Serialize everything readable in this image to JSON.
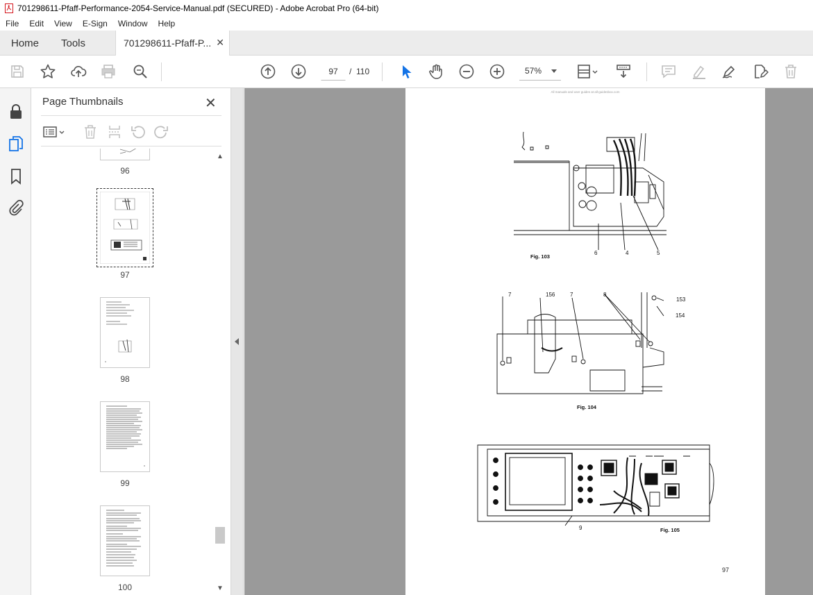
{
  "window": {
    "title": "701298611-Pfaff-Performance-2054-Service-Manual.pdf (SECURED) - Adobe Acrobat Pro (64-bit)"
  },
  "menu": [
    "File",
    "Edit",
    "View",
    "E-Sign",
    "Window",
    "Help"
  ],
  "tabs": {
    "home": "Home",
    "tools": "Tools",
    "document": "701298611-Pfaff-P...",
    "close": "✕"
  },
  "toolbar": {
    "current_page": "97",
    "page_separator": "/",
    "total_pages": "110",
    "zoom": "57%"
  },
  "panel": {
    "title": "Page Thumbnails",
    "close": "✕"
  },
  "thumbnails": [
    {
      "label": "96"
    },
    {
      "label": "97",
      "selected": true
    },
    {
      "label": "98"
    },
    {
      "label": "99"
    },
    {
      "label": "100"
    }
  ],
  "page": {
    "header": "All manuals and user guides at all-guidesbox.com",
    "number": "97",
    "figures": {
      "fig103": {
        "caption": "Fig. 103",
        "callouts": [
          "6",
          "4",
          "5"
        ]
      },
      "fig104": {
        "caption": "Fig. 104",
        "callouts": [
          "7",
          "156",
          "7",
          "8",
          "153",
          "154"
        ]
      },
      "fig105": {
        "caption": "Fig. 105",
        "callouts": [
          "9"
        ]
      }
    }
  },
  "colors": {
    "accent": "#1473e6",
    "doc_background": "#9a9a9a",
    "pdf_icon": "#d4151c"
  }
}
